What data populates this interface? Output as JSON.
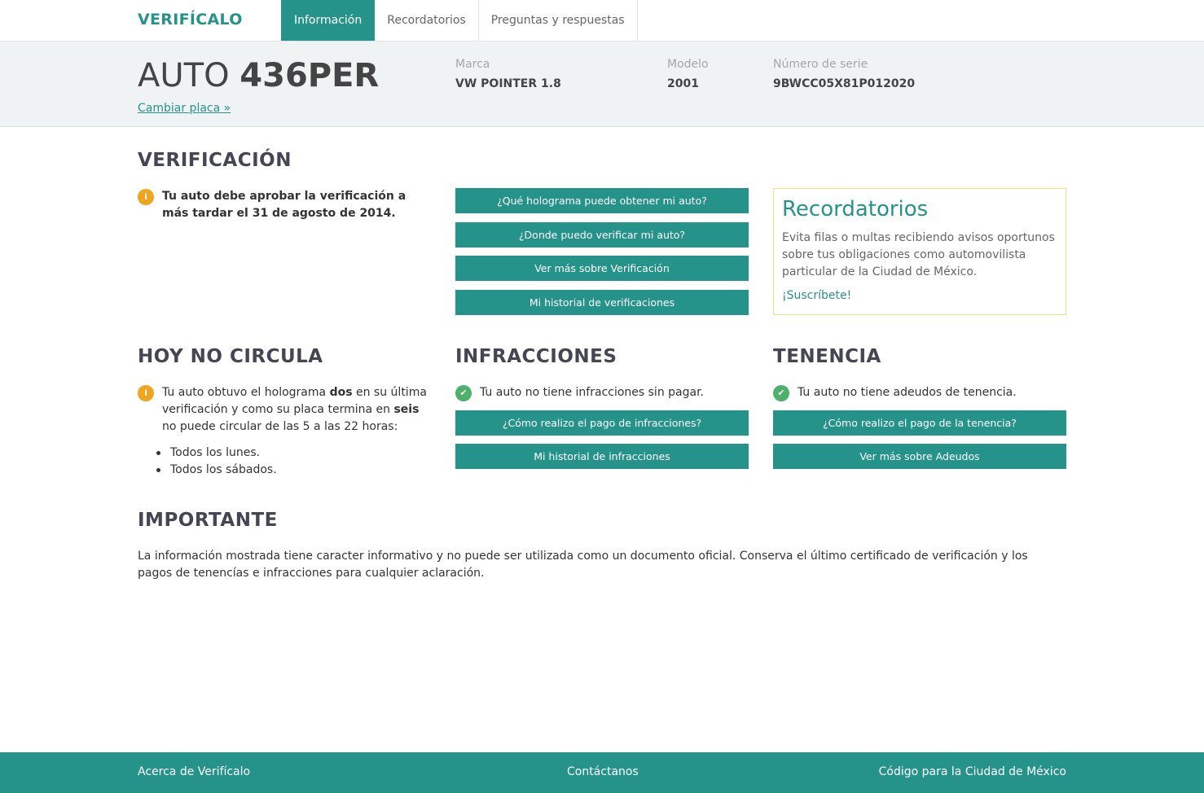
{
  "brand": "VERIFÍCALO",
  "nav": [
    {
      "label": "Información",
      "active": true
    },
    {
      "label": "Recordatorios",
      "active": false
    },
    {
      "label": "Preguntas y respuestas",
      "active": false
    }
  ],
  "vehicle": {
    "prefix": "AUTO",
    "plate": "436PER",
    "change_plate": "Cambiar placa »",
    "brand_label": "Marca",
    "brand_value": "VW POINTER 1.8",
    "model_label": "Modelo",
    "model_value": "2001",
    "serial_label": "Número de serie",
    "serial_value": "9BWCC05X81P012020"
  },
  "verificacion": {
    "title": "VERIFICACIÓN",
    "notice": "Tu auto debe aprobar la verificación a más tardar el 31 de agosto de 2014.",
    "buttons": [
      "¿Qué holograma puede obtener mi auto?",
      "¿Donde puedo verificar mi auto?",
      "Ver más sobre Verificación",
      "Mi historial de verificaciones"
    ]
  },
  "recordatorios": {
    "title": "Recordatorios",
    "text": "Evita filas o multas recibiendo avisos oportunos sobre tus obligaciones como automovilista particular de la Ciudad de México.",
    "link": "¡Suscríbete!"
  },
  "hoy_no_circula": {
    "title": "HOY NO CIRCULA",
    "text_1": "Tu auto obtuvo el holograma ",
    "hologram": "dos",
    "text_2": " en su última verificación y como su placa termina en ",
    "ending": "seis",
    "text_3": " no puede circular de las 5 a las 22 horas:",
    "days": [
      "Todos los lunes.",
      "Todos los sábados."
    ]
  },
  "infracciones": {
    "title": "INFRACCIONES",
    "status": "Tu auto no tiene infracciones sin pagar.",
    "buttons": [
      "¿Cómo realizo el pago de infracciones?",
      "Mi historial de infracciones"
    ]
  },
  "tenencia": {
    "title": "TENENCIA",
    "status": "Tu auto no tiene adeudos de tenencia.",
    "buttons": [
      "¿Cómo realizo el pago de la tenencia?",
      "Ver más sobre Adeudos"
    ]
  },
  "importante": {
    "title": "IMPORTANTE",
    "text": "La información mostrada tiene caracter informativo y no puede ser utilizada como un documento oficial. Conserva el último certificado de verificación y los pagos de tenencías e infracciones para cualquier aclaración."
  },
  "footer": {
    "about": "Acerca de Verifícalo",
    "contact": "Contáctanos",
    "code": "Código para la Ciudad de México"
  },
  "colors": {
    "accent": "#26938b",
    "info": "#f1a51f",
    "ok": "#4db06b"
  },
  "icons": {
    "info": "info-icon",
    "check": "check-icon"
  }
}
